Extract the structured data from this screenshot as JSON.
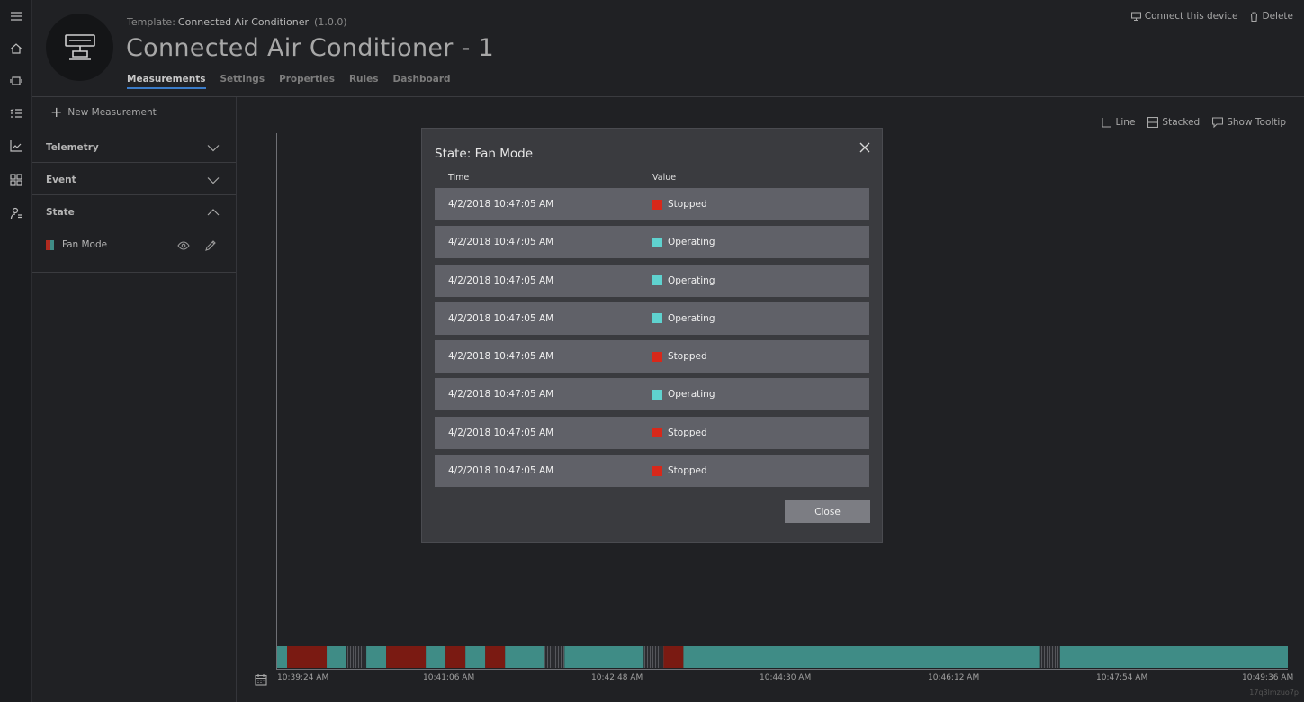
{
  "header": {
    "template_prefix": "Template:",
    "template_name": "Connected Air Conditioner",
    "template_version": "(1.0.0)",
    "device_title": "Connected Air Conditioner - 1",
    "tabs": [
      {
        "label": "Measurements",
        "active": true
      },
      {
        "label": "Settings",
        "active": false
      },
      {
        "label": "Properties",
        "active": false
      },
      {
        "label": "Rules",
        "active": false
      },
      {
        "label": "Dashboard",
        "active": false
      }
    ],
    "actions": {
      "connect_label": "Connect this device",
      "delete_label": "Delete"
    }
  },
  "measurements": {
    "new_label": "New Measurement",
    "sections": [
      {
        "label": "Telemetry",
        "expanded": false
      },
      {
        "label": "Event",
        "expanded": false
      },
      {
        "label": "State",
        "expanded": true
      }
    ],
    "items": [
      {
        "label": "Fan Mode"
      }
    ]
  },
  "chart_tools": {
    "line_label": "Line",
    "stacked_label": "Stacked",
    "tooltip_label": "Show Tooltip"
  },
  "colors": {
    "operating": "#3f8c86",
    "stopped": "#7a1a12",
    "accent": "#3b7cc9",
    "operating_legend": "#5fd2cf",
    "stopped_legend": "#d8281a"
  },
  "chart_data": {
    "type": "bar",
    "title": "",
    "x_ticks": [
      "10:39:24 AM",
      "10:41:06 AM",
      "10:42:48 AM",
      "10:44:30 AM",
      "10:46:12 AM",
      "10:47:54 AM",
      "10:49:36 AM"
    ],
    "x_range_seconds": [
      0,
      612
    ],
    "series": [
      {
        "name": "Fan Mode",
        "segments": [
          {
            "state": "Operating",
            "start": 0,
            "end": 6
          },
          {
            "state": "Stopped",
            "start": 6,
            "end": 30
          },
          {
            "state": "Operating",
            "start": 30,
            "end": 42
          },
          {
            "state": "No data",
            "start": 42,
            "end": 54
          },
          {
            "state": "Operating",
            "start": 54,
            "end": 66
          },
          {
            "state": "Stopped",
            "start": 66,
            "end": 90
          },
          {
            "state": "Operating",
            "start": 90,
            "end": 102
          },
          {
            "state": "Stopped",
            "start": 102,
            "end": 114
          },
          {
            "state": "Operating",
            "start": 114,
            "end": 126
          },
          {
            "state": "Stopped",
            "start": 126,
            "end": 138
          },
          {
            "state": "Operating",
            "start": 138,
            "end": 162
          },
          {
            "state": "No data",
            "start": 162,
            "end": 174
          },
          {
            "state": "Operating",
            "start": 174,
            "end": 222
          },
          {
            "state": "No data",
            "start": 222,
            "end": 234
          },
          {
            "state": "Stopped",
            "start": 234,
            "end": 246
          },
          {
            "state": "Operating",
            "start": 246,
            "end": 462
          },
          {
            "state": "No data",
            "start": 462,
            "end": 474
          },
          {
            "state": "Operating",
            "start": 474,
            "end": 612
          }
        ]
      }
    ]
  },
  "modal": {
    "title": "State: Fan Mode",
    "col_time": "Time",
    "col_value": "Value",
    "rows": [
      {
        "time": "4/2/2018 10:47:05 AM",
        "value": "Stopped",
        "color": "#d8281a"
      },
      {
        "time": "4/2/2018 10:47:05 AM",
        "value": "Operating",
        "color": "#5fd2cf"
      },
      {
        "time": "4/2/2018 10:47:05 AM",
        "value": "Operating",
        "color": "#5fd2cf"
      },
      {
        "time": "4/2/2018 10:47:05 AM",
        "value": "Operating",
        "color": "#5fd2cf"
      },
      {
        "time": "4/2/2018 10:47:05 AM",
        "value": "Stopped",
        "color": "#d8281a"
      },
      {
        "time": "4/2/2018 10:47:05 AM",
        "value": "Operating",
        "color": "#5fd2cf"
      },
      {
        "time": "4/2/2018 10:47:05 AM",
        "value": "Stopped",
        "color": "#d8281a"
      },
      {
        "time": "4/2/2018 10:47:05 AM",
        "value": "Stopped",
        "color": "#d8281a"
      }
    ],
    "close_label": "Close"
  },
  "footer_id": "17q3lmzuo7p"
}
